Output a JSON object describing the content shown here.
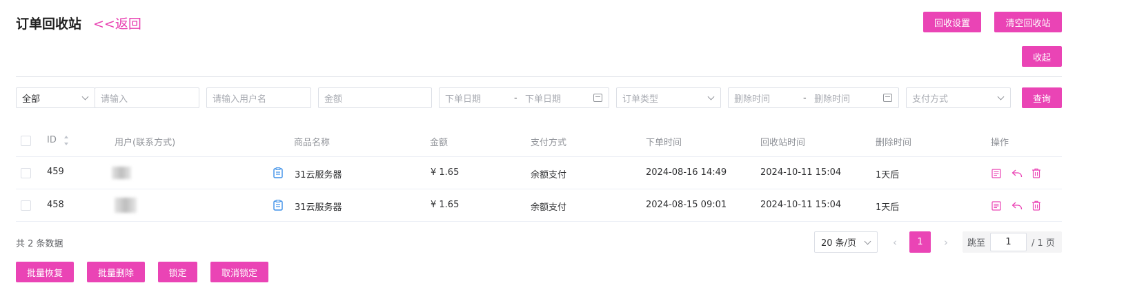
{
  "header": {
    "title": "订单回收站",
    "back_label": "<<返回",
    "recycle_settings_label": "回收设置",
    "clear_recycle_label": "清空回收站",
    "collapse_label": "收起"
  },
  "colors": {
    "accent": "#ea44b5",
    "link": "#e83fb0",
    "icon_blue": "#3b8fe8"
  },
  "filters": {
    "scope_value": "全部",
    "keyword_placeholder": "请输入",
    "username_placeholder": "请输入用户名",
    "amount_placeholder": "金额",
    "order_date_start_placeholder": "下单日期",
    "order_date_separator": "-",
    "order_date_end_placeholder": "下单日期",
    "order_type_placeholder": "订单类型",
    "delete_time_start_placeholder": "删除时间",
    "delete_time_separator": "-",
    "delete_time_end_placeholder": "删除时间",
    "pay_method_placeholder": "支付方式",
    "query_label": "查询"
  },
  "table": {
    "columns": [
      "ID",
      "用户(联系方式)",
      "商品名称",
      "金额",
      "支付方式",
      "下单时间",
      "回收站时间",
      "删除时间",
      "操作"
    ],
    "rows": [
      {
        "id": "459",
        "product_icon": "document-icon",
        "product": "31云服务器",
        "amount": "¥ 1.65",
        "pay_method": "余额支付",
        "order_time": "2024-08-16 14:49",
        "recycle_time": "2024-10-11 15:04",
        "delete_time": "1天后"
      },
      {
        "id": "458",
        "product_icon": "document-icon",
        "product": "31云服务器",
        "amount": "¥ 1.65",
        "pay_method": "余额支付",
        "order_time": "2024-08-15 09:01",
        "recycle_time": "2024-10-11 15:04",
        "delete_time": "1天后"
      }
    ],
    "row_actions": [
      "detail-icon",
      "restore-icon",
      "delete-icon"
    ]
  },
  "footer": {
    "total_text": "共 2 条数据",
    "page_size_value": "20 条/页",
    "current_page": "1",
    "jump_label": "跳至",
    "jump_value": "1",
    "total_pages_text": "/ 1 页",
    "batch_restore_label": "批量恢复",
    "batch_delete_label": "批量删除",
    "lock_label": "锁定",
    "unlock_label": "取消锁定"
  }
}
